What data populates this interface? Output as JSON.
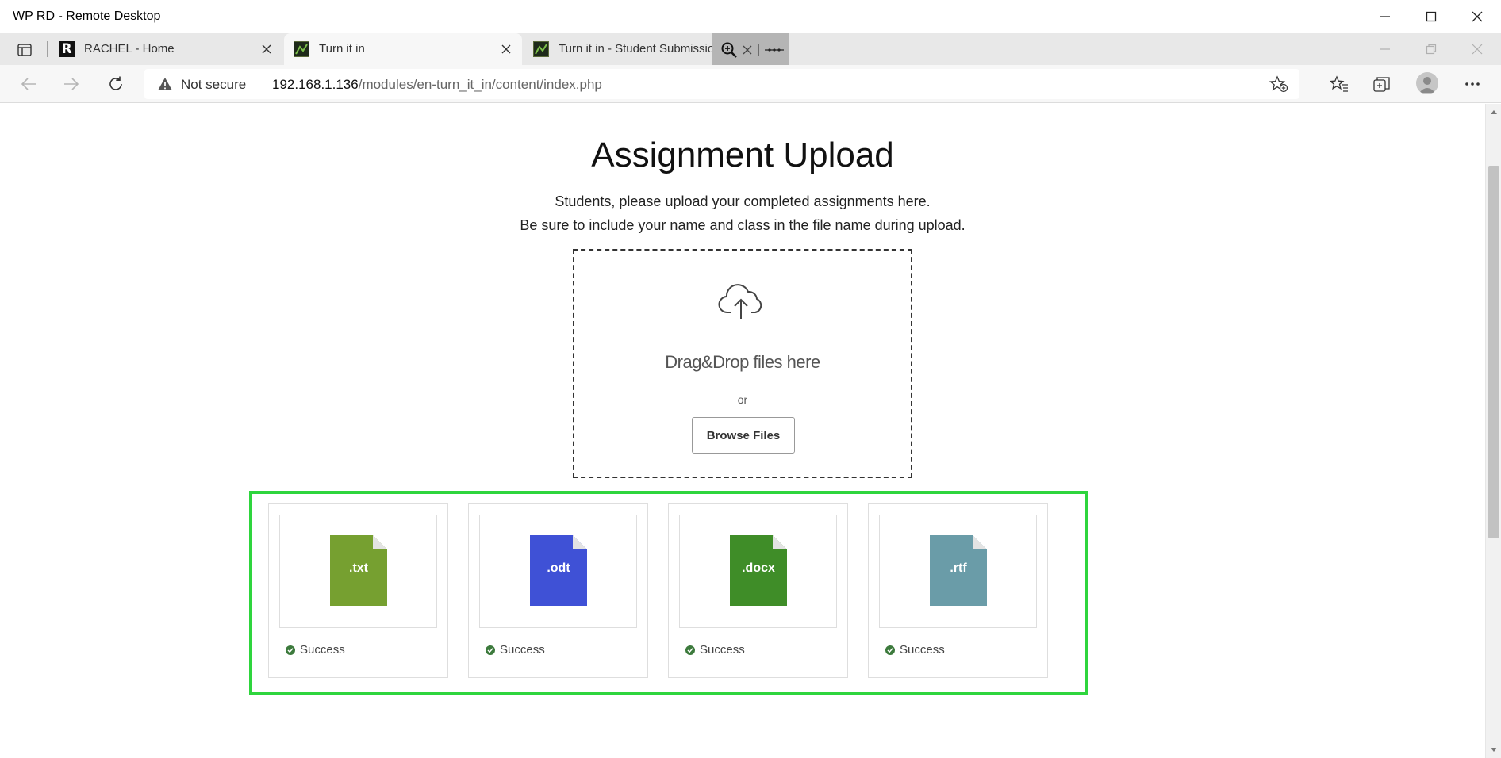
{
  "window": {
    "title": "WP RD - Remote Desktop"
  },
  "tabs": [
    {
      "label": "RACHEL - Home",
      "favicon": "rachel-r-icon",
      "active": false
    },
    {
      "label": "Turn it in",
      "favicon": "turnitin-icon",
      "active": true
    },
    {
      "label": "Turn it in - Student Submission",
      "favicon": "turnitin-icon",
      "active": false
    }
  ],
  "addressbar": {
    "security_label": "Not secure",
    "url_host": "192.168.1.136",
    "url_path": "/modules/en-turn_it_in/content/index.php"
  },
  "page": {
    "title": "Assignment Upload",
    "intro_line1": "Students, please upload your completed assignments here.",
    "intro_line2": "Be sure to include your name and class in the file name during upload."
  },
  "dropzone": {
    "prompt": "Drag&Drop files here",
    "or_text": "or",
    "browse_label": "Browse Files"
  },
  "files": [
    {
      "ext": ".txt",
      "status": "Success",
      "color": "#76a030"
    },
    {
      "ext": ".odt",
      "status": "Success",
      "color": "#3f51d6"
    },
    {
      "ext": ".docx",
      "status": "Success",
      "color": "#3f8d28"
    },
    {
      "ext": ".rtf",
      "status": "Success",
      "color": "#6a9ca8"
    }
  ],
  "colors": {
    "highlight_border": "#2ed53d",
    "success_check": "#3c7a3c"
  }
}
